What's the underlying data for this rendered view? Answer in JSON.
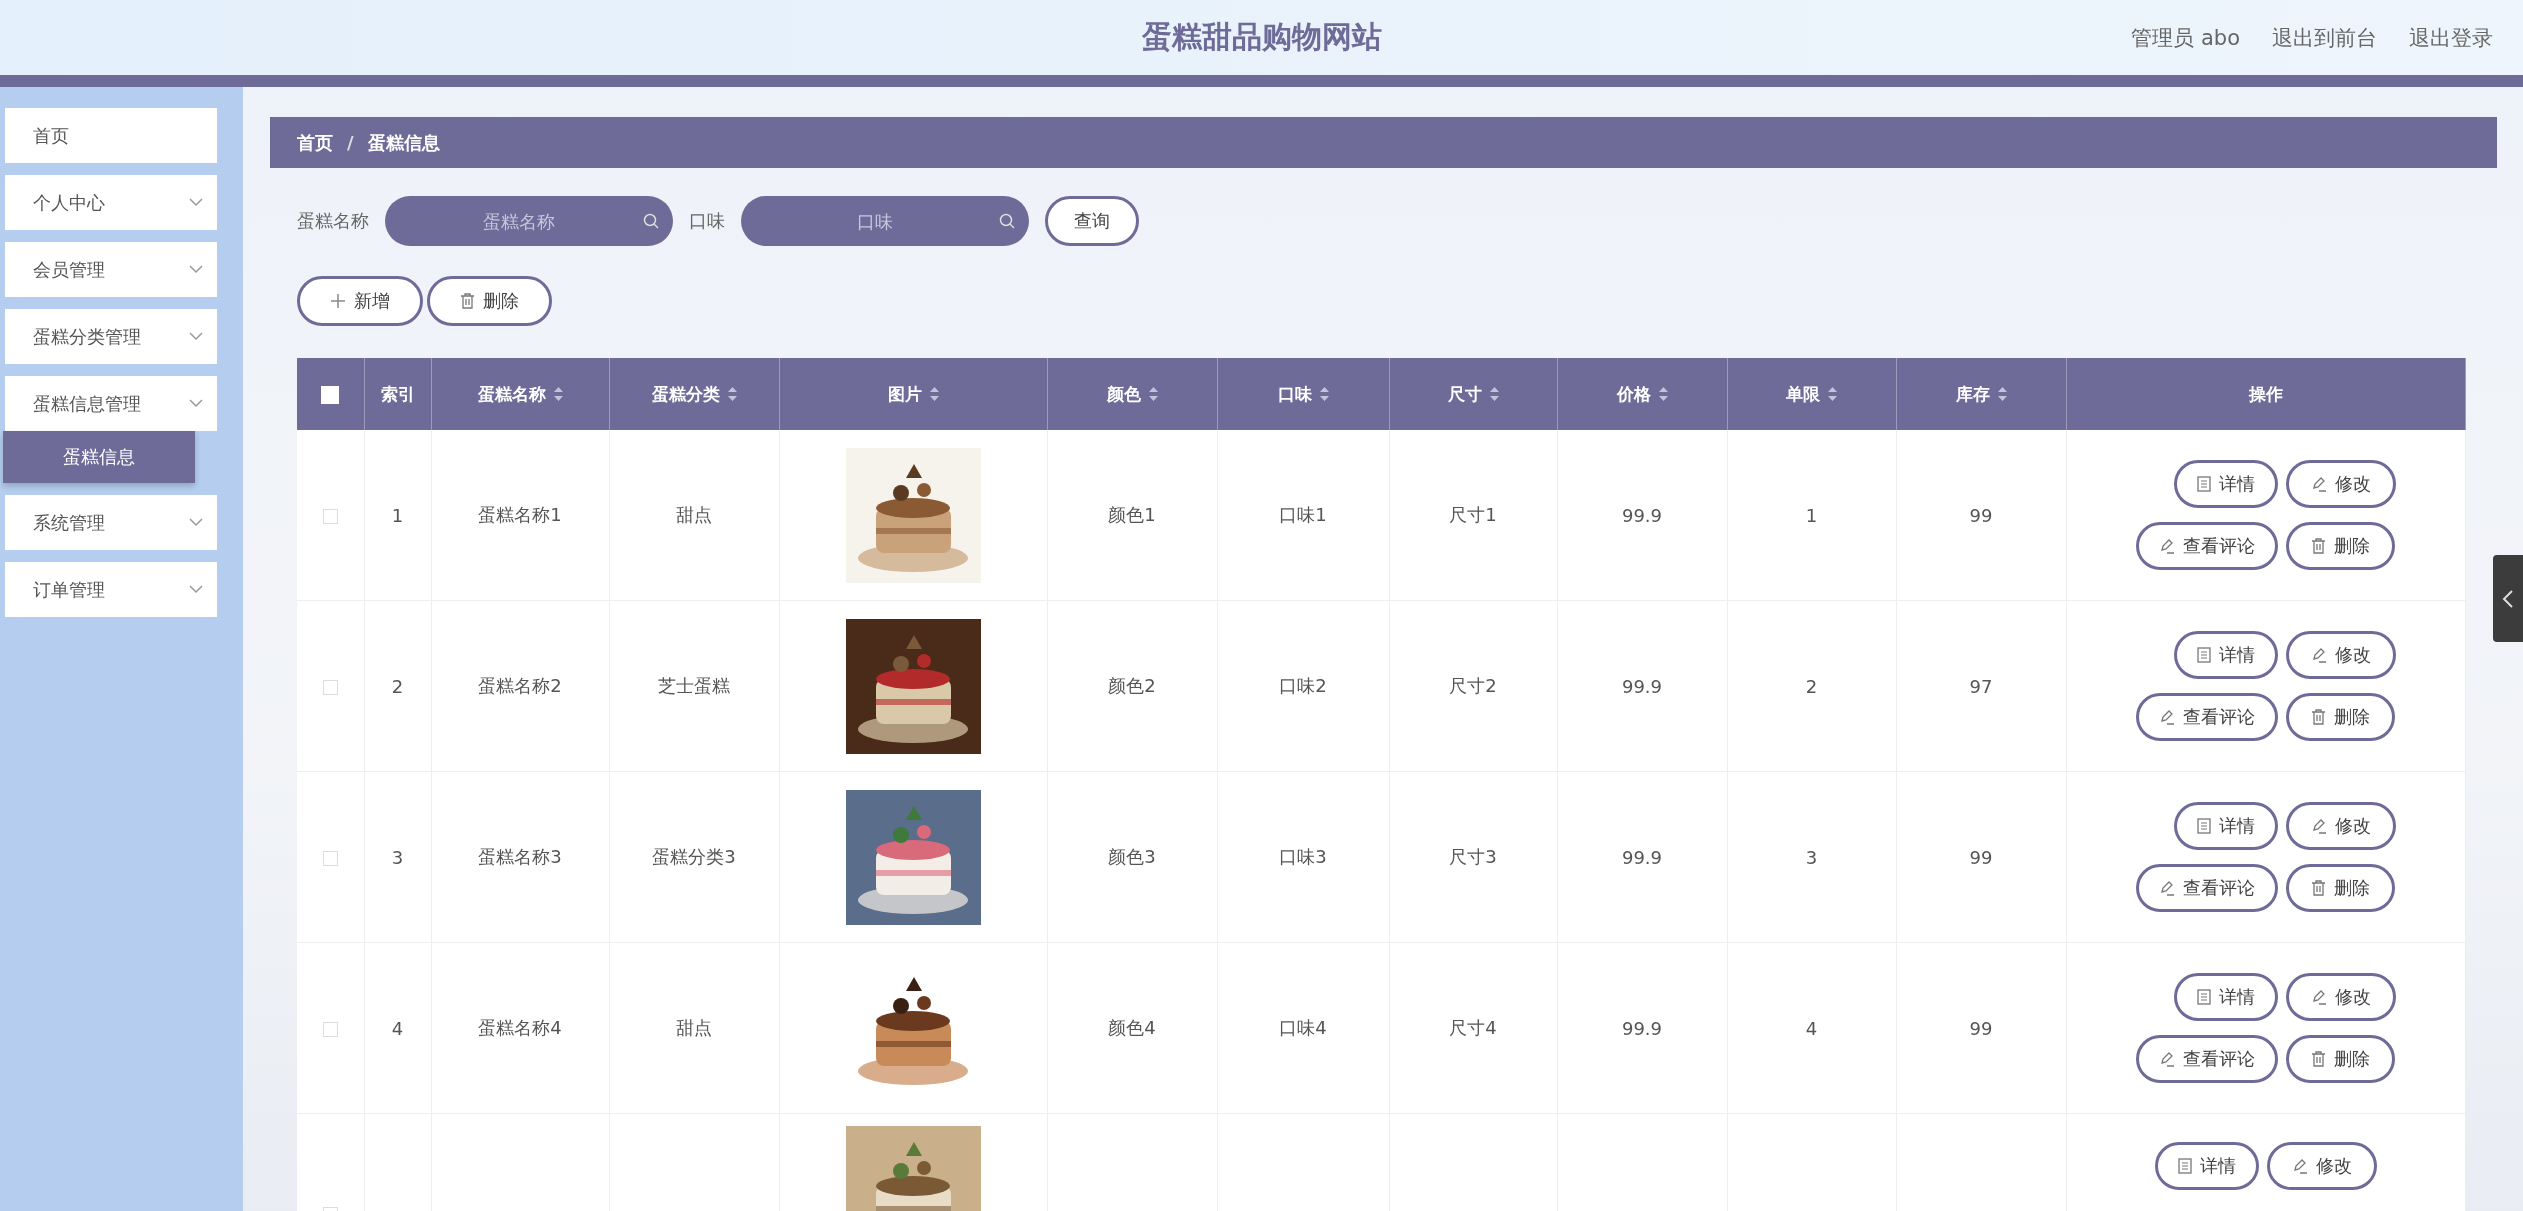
{
  "header": {
    "title": "蛋糕甜品购物网站",
    "links": [
      "管理员 abo",
      "退出到前台",
      "退出登录"
    ]
  },
  "sidebar": {
    "items": [
      {
        "label": "首页",
        "expandable": false
      },
      {
        "label": "个人中心",
        "expandable": true
      },
      {
        "label": "会员管理",
        "expandable": true
      },
      {
        "label": "蛋糕分类管理",
        "expandable": true
      },
      {
        "label": "蛋糕信息管理",
        "expandable": true,
        "children": [
          {
            "label": "蛋糕信息",
            "selected": true
          }
        ]
      },
      {
        "label": "系统管理",
        "expandable": true
      },
      {
        "label": "订单管理",
        "expandable": true
      }
    ]
  },
  "breadcrumb": {
    "separator": "/",
    "items": [
      "首页",
      "蛋糕信息"
    ]
  },
  "search": {
    "fields": [
      {
        "label": "蛋糕名称",
        "placeholder": "蛋糕名称"
      },
      {
        "label": "口味",
        "placeholder": "口味"
      }
    ],
    "button": "查询"
  },
  "toolbar": [
    {
      "kind": "add",
      "label": "新增"
    },
    {
      "kind": "delete",
      "label": "删除"
    }
  ],
  "table": {
    "select_all": {
      "checked": false
    },
    "columns": [
      {
        "label": "索引",
        "sortable": false
      },
      {
        "label": "蛋糕名称",
        "sortable": true
      },
      {
        "label": "蛋糕分类",
        "sortable": true
      },
      {
        "label": "图片",
        "sortable": true
      },
      {
        "label": "颜色",
        "sortable": true
      },
      {
        "label": "口味",
        "sortable": true
      },
      {
        "label": "尺寸",
        "sortable": true
      },
      {
        "label": "价格",
        "sortable": true
      },
      {
        "label": "单限",
        "sortable": true
      },
      {
        "label": "库存",
        "sortable": true
      },
      {
        "label": "操作",
        "sortable": false
      }
    ],
    "rows": [
      {
        "checked": false,
        "cells": [
          "1",
          "蛋糕名称1",
          "甜点"
        ],
        "picture": {
          "kind": "picture"
        },
        "cells_after": [
          "颜色1",
          "口味1",
          "尺寸1",
          "99.9",
          "1",
          "99"
        ],
        "actions": [
          {
            "kind": "detail",
            "label": "详情"
          },
          {
            "kind": "edit",
            "label": "修改"
          },
          {
            "kind": "comment",
            "label": "查看评论"
          },
          {
            "kind": "delete",
            "label": "删除"
          }
        ]
      },
      {
        "checked": false,
        "cells": [
          "2",
          "蛋糕名称2",
          "芝士蛋糕"
        ],
        "picture": {
          "kind": "picture"
        },
        "cells_after": [
          "颜色2",
          "口味2",
          "尺寸2",
          "99.9",
          "2",
          "97"
        ],
        "actions": [
          {
            "kind": "detail",
            "label": "详情"
          },
          {
            "kind": "edit",
            "label": "修改"
          },
          {
            "kind": "comment",
            "label": "查看评论"
          },
          {
            "kind": "delete",
            "label": "删除"
          }
        ]
      },
      {
        "checked": false,
        "cells": [
          "3",
          "蛋糕名称3",
          "蛋糕分类3"
        ],
        "picture": {
          "kind": "picture"
        },
        "cells_after": [
          "颜色3",
          "口味3",
          "尺寸3",
          "99.9",
          "3",
          "99"
        ],
        "actions": [
          {
            "kind": "detail",
            "label": "详情"
          },
          {
            "kind": "edit",
            "label": "修改"
          },
          {
            "kind": "comment",
            "label": "查看评论"
          },
          {
            "kind": "delete",
            "label": "删除"
          }
        ]
      },
      {
        "checked": false,
        "cells": [
          "4",
          "蛋糕名称4",
          "甜点"
        ],
        "picture": {
          "kind": "picture"
        },
        "cells_after": [
          "颜色4",
          "口味4",
          "尺寸4",
          "99.9",
          "4",
          "99"
        ],
        "actions": [
          {
            "kind": "detail",
            "label": "详情"
          },
          {
            "kind": "edit",
            "label": "修改"
          },
          {
            "kind": "comment",
            "label": "查看评论"
          },
          {
            "kind": "delete",
            "label": "删除"
          }
        ]
      },
      {
        "checked": false,
        "picture": {
          "kind": "picture"
        },
        "actions": [
          {
            "kind": "detail",
            "label": "详情"
          },
          {
            "kind": "edit",
            "label": "修改"
          }
        ]
      }
    ]
  }
}
